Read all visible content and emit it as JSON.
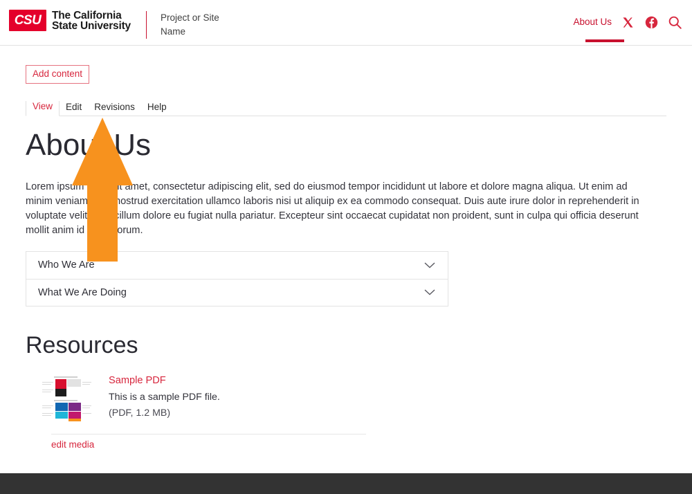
{
  "header": {
    "logo_text": "CSU",
    "brand_line1": "The California",
    "brand_line2": "State University",
    "project_name": "Project or Site Name",
    "nav_link": "About Us",
    "icons": {
      "x": "x-twitter-icon",
      "facebook": "facebook-icon",
      "search": "search-icon"
    }
  },
  "admin": {
    "add_content_label": "Add content",
    "tabs": [
      {
        "label": "View",
        "active": true
      },
      {
        "label": "Edit",
        "active": false
      },
      {
        "label": "Revisions",
        "active": false
      },
      {
        "label": "Help",
        "active": false
      }
    ]
  },
  "main": {
    "page_title": "About Us",
    "intro": "Lorem ipsum dolor sit amet, consectetur adipiscing elit, sed do eiusmod tempor incididunt ut labore et dolore magna aliqua. Ut enim ad minim veniam, quis nostrud exercitation ullamco laboris nisi ut aliquip ex ea commodo consequat. Duis aute irure dolor in reprehenderit in voluptate velit esse cillum dolore eu fugiat nulla pariatur. Excepteur sint occaecat cupidatat non proident, sunt in culpa qui officia deserunt mollit anim id est laborum.",
    "accordion": [
      {
        "label": "Who We Are"
      },
      {
        "label": "What We Are Doing"
      }
    ],
    "resources_title": "Resources",
    "resource": {
      "title": "Sample PDF",
      "description": "This is a sample PDF file.",
      "meta": "(PDF, 1.2 MB)",
      "thumbnail_name": "pdf-page-thumbnail"
    },
    "edit_media_label": "edit media"
  },
  "overlay": {
    "cursor_name": "orange-arrow-pointer",
    "color": "#F7921E"
  },
  "colors": {
    "brand_red": "#C8102E",
    "link_red": "#D7263D",
    "logo_red": "#E4002B",
    "footer_dark": "#333333",
    "arrow_orange": "#F7921E"
  }
}
